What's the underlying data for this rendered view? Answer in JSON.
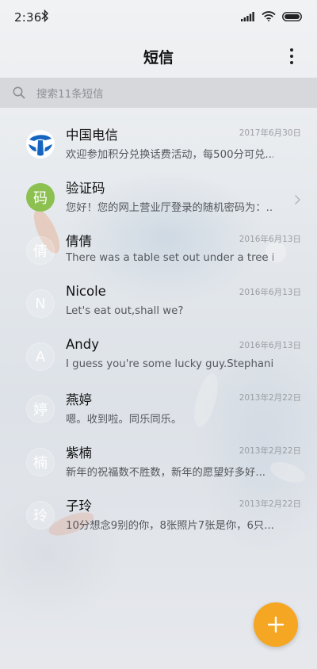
{
  "status_bar": {
    "time": "2:36",
    "icons": [
      "bluetooth-icon",
      "signal-icon",
      "wifi-icon",
      "battery-icon"
    ]
  },
  "header": {
    "title": "短信",
    "menu_icon": "more-vertical-icon"
  },
  "search": {
    "placeholder": "搜索11条短信",
    "icon": "search-icon"
  },
  "conversations": [
    {
      "avatar_type": "logo",
      "avatar_text": "",
      "name": "中国电信",
      "date": "2017年6月30日",
      "preview": "欢迎参加积分兑换话费活动，每500分可兑..."
    },
    {
      "avatar_type": "green",
      "avatar_text": "码",
      "name": "验证码",
      "date": "",
      "preview": "您好！您的网上营业厅登录的随机密码为：...",
      "has_chevron": true
    },
    {
      "avatar_type": "ghost",
      "avatar_text": "倩",
      "name": "倩倩",
      "date": "2016年6月13日",
      "preview": "There was a table set out under a tree in..."
    },
    {
      "avatar_type": "ghost",
      "avatar_text": "N",
      "name": "Nicole",
      "date": "2016年6月13日",
      "preview": "Let's eat out,shall we?"
    },
    {
      "avatar_type": "ghost",
      "avatar_text": "A",
      "name": "Andy",
      "date": "2016年6月13日",
      "preview": "I guess you're some lucky guy.Stephani..."
    },
    {
      "avatar_type": "ghost",
      "avatar_text": "婷",
      "name": "燕婷",
      "date": "2013年2月22日",
      "preview": "嗯。收到啦。同乐同乐。"
    },
    {
      "avatar_type": "ghost",
      "avatar_text": "楠",
      "name": "紫楠",
      "date": "2013年2月22日",
      "preview": "新年的祝福数不胜数，新年的愿望好多好..."
    },
    {
      "avatar_type": "ghost",
      "avatar_text": "玲",
      "name": "子玲",
      "date": "2013年2月22日",
      "preview": "10分想念9别的你，8张照片7张是你，6只..."
    }
  ],
  "fab": {
    "icon": "plus-icon",
    "color": "#f5a623"
  },
  "colors": {
    "accent": "#f5a623",
    "verify_avatar": "#8cc151",
    "telecom_blue": "#1565c0"
  }
}
